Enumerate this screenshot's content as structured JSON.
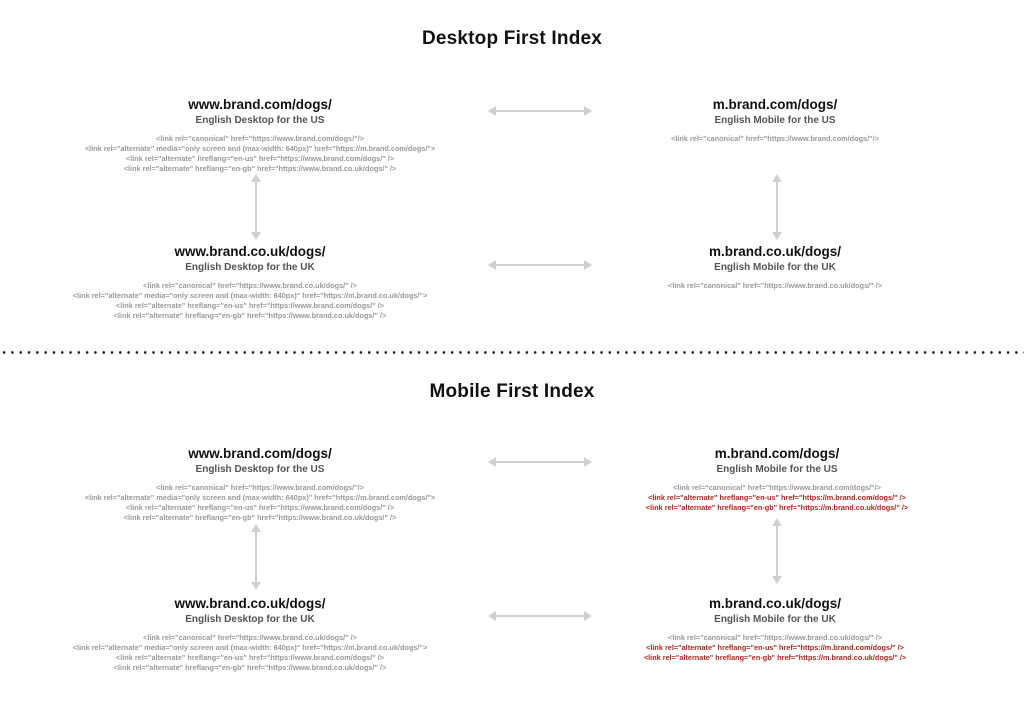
{
  "sections": [
    {
      "title": "Desktop First Index",
      "nodes": {
        "desktop_us": {
          "url": "www.brand.com/dogs/",
          "subtitle": "English Desktop for the US",
          "lines": [
            {
              "text": "<link rel=\"canonical\" href=\"https://www.brand.com/dogs/\"/>",
              "highlight": false
            },
            {
              "text": "<link rel=\"alternate\" media=\"only screen and (max-width: 640px)\" href=\"https://m.brand.com/dogs/\">",
              "highlight": false
            },
            {
              "text": "<link rel=\"alternate\" hreflang=\"en-us\" href=\"https://www.brand.com/dogs/\" />",
              "highlight": false
            },
            {
              "text": "<link rel=\"alternate\" hreflang=\"en-gb\" href=\"https://www.brand.co.uk/dogs/\" />",
              "highlight": false
            }
          ]
        },
        "mobile_us": {
          "url": "m.brand.com/dogs/",
          "subtitle": "English Mobile for the US",
          "lines": [
            {
              "text": "<link rel=\"canonical\" href=\"https://www.brand.com/dogs/\"/>",
              "highlight": false
            }
          ]
        },
        "desktop_uk": {
          "url": "www.brand.co.uk/dogs/",
          "subtitle": "English Desktop for the UK",
          "lines": [
            {
              "text": "<link rel=\"canonical\" href=\"https://www.brand.co.uk/dogs/\" />",
              "highlight": false
            },
            {
              "text": "<link rel=\"alternate\" media=\"only screen and (max-width: 640px)\" href=\"https://m.brand.co.uk/dogs/\">",
              "highlight": false
            },
            {
              "text": "<link rel=\"alternate\" hreflang=\"en-us\" href=\"https://www.brand.com/dogs/\" />",
              "highlight": false
            },
            {
              "text": "<link rel=\"alternate\" hreflang=\"en-gb\" href=\"https://www.brand.co.uk/dogs/\" />",
              "highlight": false
            }
          ]
        },
        "mobile_uk": {
          "url": "m.brand.co.uk/dogs/",
          "subtitle": "English Mobile for the UK",
          "lines": [
            {
              "text": "<link rel=\"canonical\" href=\"https://www.brand.co.uk/dogs/\" />",
              "highlight": false
            }
          ]
        }
      }
    },
    {
      "title": "Mobile First Index",
      "nodes": {
        "desktop_us": {
          "url": "www.brand.com/dogs/",
          "subtitle": "English Desktop for the US",
          "lines": [
            {
              "text": "<link rel=\"canonical\" href=\"https://www.brand.com/dogs/\"/>",
              "highlight": false
            },
            {
              "text": "<link rel=\"alternate\" media=\"only screen and (max-width: 640px)\" href=\"https://m.brand.com/dogs/\">",
              "highlight": false
            },
            {
              "text": "<link rel=\"alternate\" hreflang=\"en-us\" href=\"https://www.brand.com/dogs/\" />",
              "highlight": false
            },
            {
              "text": "<link rel=\"alternate\" hreflang=\"en-gb\" href=\"https://www.brand.co.uk/dogs/\" />",
              "highlight": false
            }
          ]
        },
        "mobile_us": {
          "url": "m.brand.com/dogs/",
          "subtitle": "English Mobile for the US",
          "lines": [
            {
              "text": "<link rel=\"canonical\" href=\"https://www.brand.com/dogs/\"/>",
              "highlight": false
            },
            {
              "text": "<link rel=\"alternate\" hreflang=\"en-us\" href=\"https://m.brand.com/dogs/\" />",
              "highlight": true
            },
            {
              "text": "<link rel=\"alternate\" hreflang=\"en-gb\" href=\"https://m.brand.co.uk/dogs/\" />",
              "highlight": true
            }
          ]
        },
        "desktop_uk": {
          "url": "www.brand.co.uk/dogs/",
          "subtitle": "English Desktop for the UK",
          "lines": [
            {
              "text": "<link rel=\"canonical\" href=\"https://www.brand.co.uk/dogs/\" />",
              "highlight": false
            },
            {
              "text": "<link rel=\"alternate\" media=\"only screen and (max-width: 640px)\" href=\"https://m.brand.co.uk/dogs/\">",
              "highlight": false
            },
            {
              "text": "<link rel=\"alternate\" hreflang=\"en-us\" href=\"https://www.brand.com/dogs/\" />",
              "highlight": false
            },
            {
              "text": "<link rel=\"alternate\" hreflang=\"en-gb\" href=\"https://www.brand.co.uk/dogs/\" />",
              "highlight": false
            }
          ]
        },
        "mobile_uk": {
          "url": "m.brand.co.uk/dogs/",
          "subtitle": "English Mobile for the UK",
          "lines": [
            {
              "text": "<link rel=\"canonical\" href=\"https://www.brand.co.uk/dogs/\" />",
              "highlight": false
            },
            {
              "text": "<link rel=\"alternate\" hreflang=\"en-us\" href=\"https://m.brand.com/dogs/\" />",
              "highlight": true
            },
            {
              "text": "<link rel=\"alternate\" hreflang=\"en-gb\" href=\"https://m.brand.co.uk/dogs/\" />",
              "highlight": true
            }
          ]
        }
      }
    }
  ],
  "colors": {
    "code_text": "#9a9a9a",
    "highlight_text": "#b3261e",
    "arrow": "#d0d0d0"
  }
}
